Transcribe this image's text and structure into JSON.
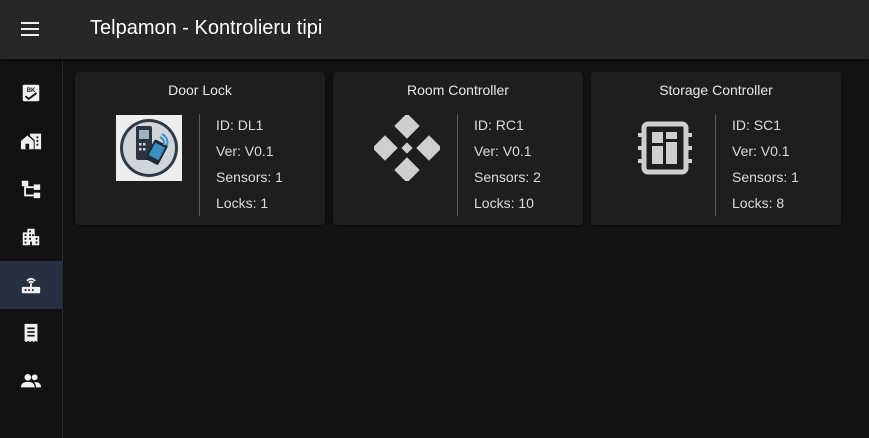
{
  "app": {
    "title": "Telpamon - Kontrolieru tipi"
  },
  "sidebar": {
    "items": [
      {
        "icon": "checklist-icon"
      },
      {
        "icon": "home-work-icon"
      },
      {
        "icon": "hierarchy-icon"
      },
      {
        "icon": "apartment-icon"
      },
      {
        "icon": "router-icon",
        "active": true
      },
      {
        "icon": "receipt-icon"
      },
      {
        "icon": "people-icon"
      }
    ]
  },
  "controllers": [
    {
      "title": "Door Lock",
      "image": "door-lock-image",
      "id_text": "ID: DL1",
      "ver_text": "Ver: V0.1",
      "sensors_text": "Sensors: 1",
      "locks_text": "Locks: 1"
    },
    {
      "title": "Room Controller",
      "image": "diamond-grid-icon",
      "id_text": "ID: RC1",
      "ver_text": "Ver: V0.1",
      "sensors_text": "Sensors: 2",
      "locks_text": "Locks: 10"
    },
    {
      "title": "Storage Controller",
      "image": "chip-icon",
      "id_text": "ID: SC1",
      "ver_text": "Ver: V0.1",
      "sensors_text": "Sensors: 1",
      "locks_text": "Locks: 8"
    }
  ],
  "colors": {
    "background": "#121212",
    "app_bar": "#272727",
    "card": "#1e1e1e",
    "active_nav": "#263040",
    "icon": "#f0f0f0"
  }
}
